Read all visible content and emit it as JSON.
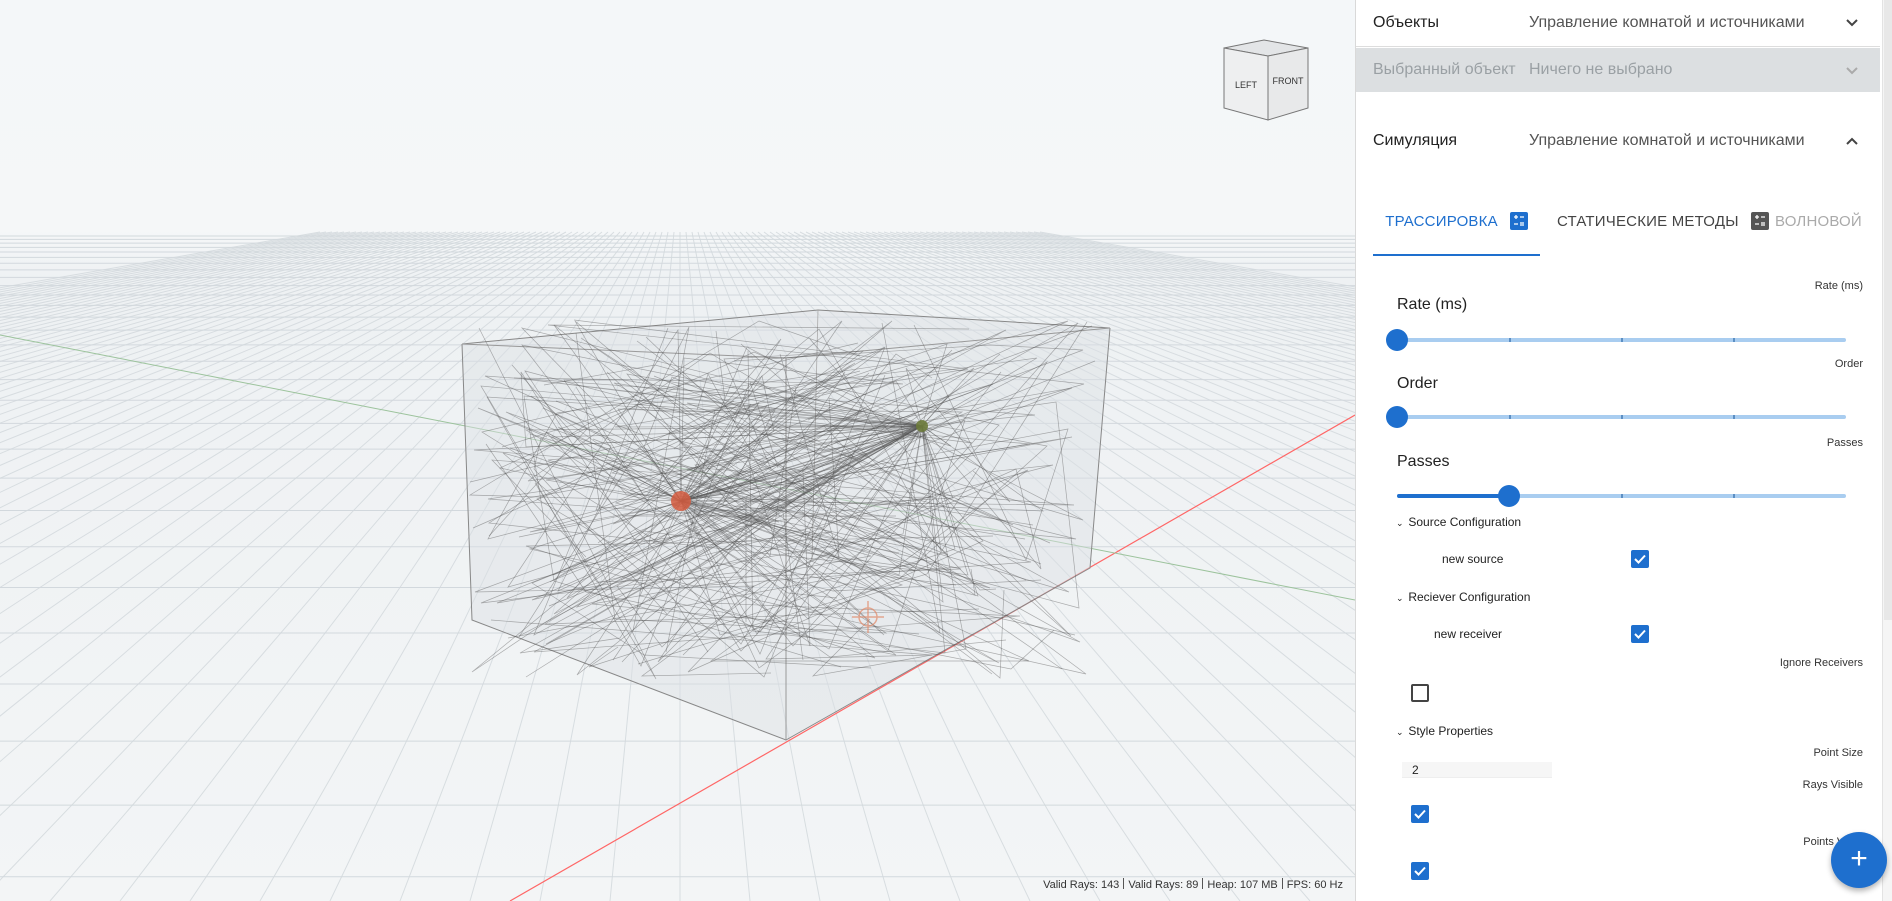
{
  "viewport": {
    "viewcube": {
      "left_label": "LEFT",
      "front_label": "FRONT"
    },
    "status": {
      "valid_rays_1": "Valid Rays: 143",
      "valid_rays_2": "Valid Rays: 89",
      "heap": "Heap: 107 MB",
      "fps": "FPS: 60 Hz"
    },
    "colors": {
      "source": "#d45a3e",
      "receiver": "#6b7a3a",
      "rays": "#555555",
      "x_axis": "#ff4a4a",
      "z_axis": "#7fb07f"
    }
  },
  "panel": {
    "objects": {
      "title": "Объекты",
      "subtitle": "Управление комнатой и источниками",
      "expanded": false
    },
    "selected": {
      "title": "Выбранный объект",
      "subtitle": "Ничего не выбрано",
      "disabled": true
    },
    "simulation": {
      "title": "Симуляция",
      "subtitle": "Управление комнатой и источниками",
      "expanded": true
    },
    "tabs": [
      {
        "label": "ТРАССИРОВКА",
        "icon": "calculator-icon",
        "active": true
      },
      {
        "label": "СТАТИЧЕСКИЕ МЕТОДЫ",
        "icon": "calculator-icon",
        "active": false
      },
      {
        "label": "ВОЛНОВОЙ",
        "active": false,
        "disabled": true
      }
    ],
    "rate": {
      "label": "Rate (ms)",
      "caption": "Rate (ms)",
      "value_fraction": 0
    },
    "order": {
      "label": "Order",
      "caption": "Order",
      "value_fraction": 0
    },
    "passes": {
      "label": "Passes",
      "caption": "Passes",
      "value_fraction": 0.25
    },
    "source_config": {
      "title": "Source Configuration",
      "items": [
        {
          "name": "new source",
          "checked": true
        }
      ]
    },
    "receiver_config": {
      "title": "Reciever Configuration",
      "items": [
        {
          "name": "new receiver",
          "checked": true
        }
      ]
    },
    "ignore_receivers": {
      "label": "Ignore Receivers",
      "checked": false
    },
    "style": {
      "title": "Style Properties",
      "point_size_label": "Point Size",
      "point_size_value": "2",
      "rays_visible_label": "Rays Visible",
      "rays_visible": true,
      "points_visible_label": "Points Visibl",
      "points_visible": true
    },
    "fab_label": "+"
  }
}
